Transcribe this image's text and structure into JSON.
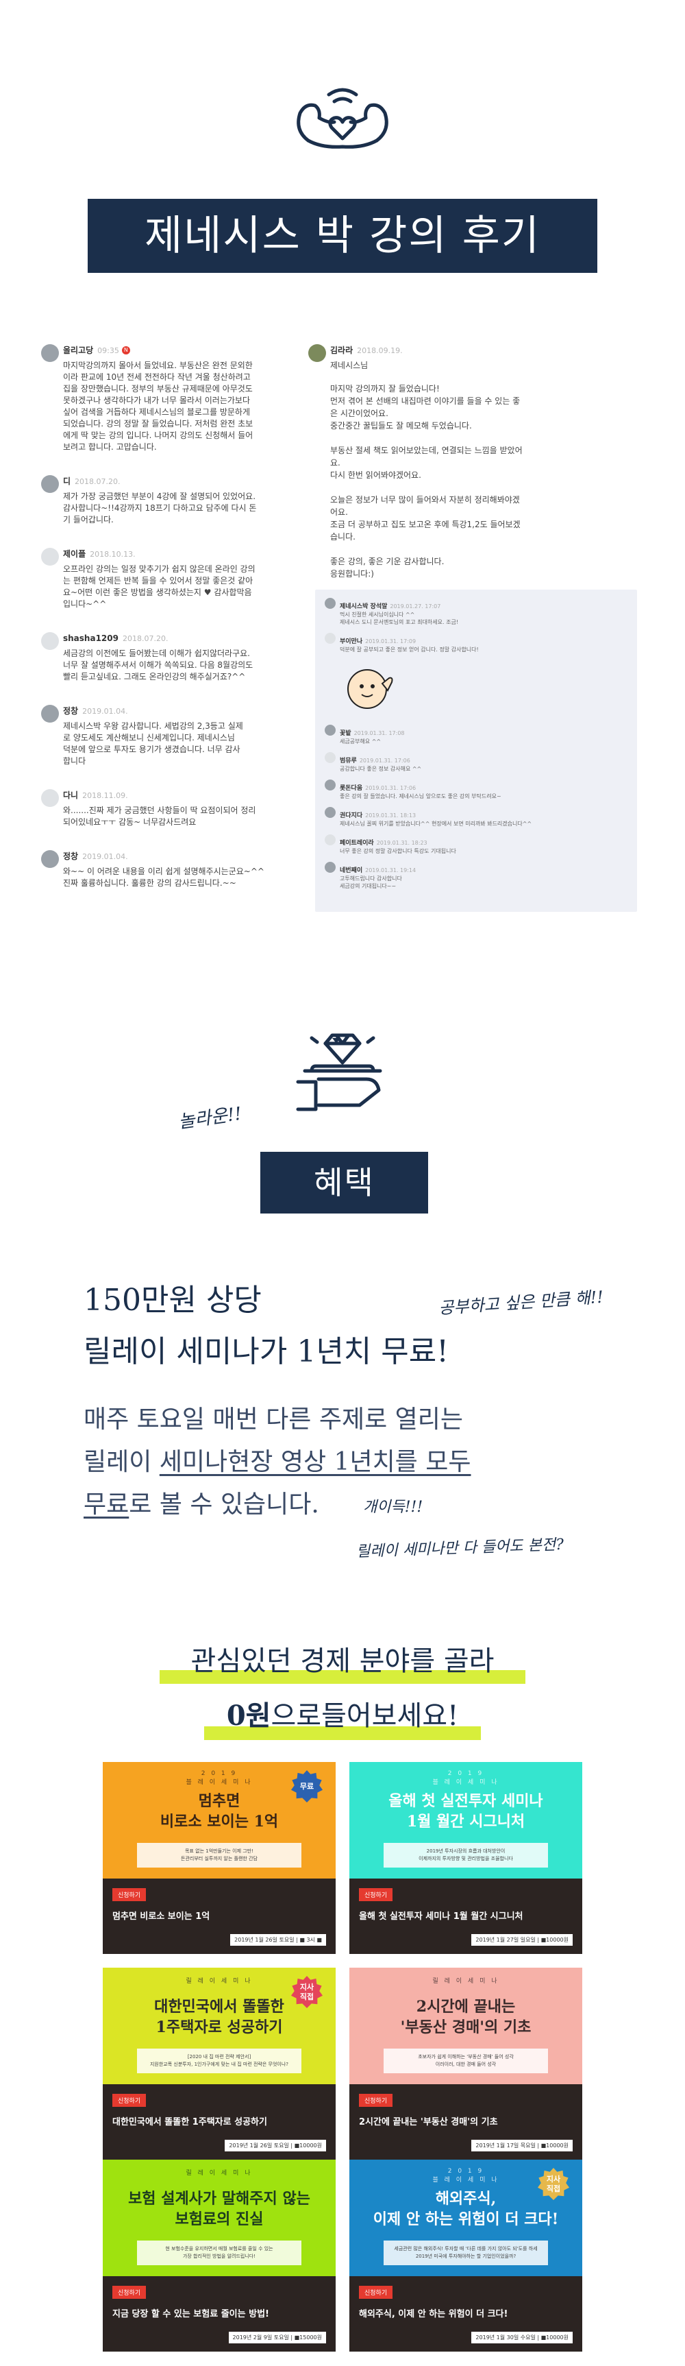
{
  "header": {
    "title": "제네시스 박 강의 후기",
    "icon": "muscle-heart-icon",
    "color_navy": "#1b2f4b"
  },
  "reviews_left": [
    {
      "name": "올리고당",
      "date": "09:35",
      "badge": "N",
      "text": "마지막강의까지 몰아서 들었네요.  부동산은 완전 문외한\n이라 판교에 10년 전세 전전하다 작년 겨울 청산하려고\n집을 장만했습니다. 정부의 부동산 규제때문에 아무것도\n못하겠구나 생각하다가 내가 너무 몰라서 이러는가보다\n싶어 검색을 거듭하다 제네시스님의 블로그를 방문하게\n되었습니다. 강의 정말 잘 들었습니다. 저처럼 완전 초보\n에게 딱 맞는 강의 입니다. 나머지 강의도 신청해서 들어\n보려고 합니다. 고맙습니다."
    },
    {
      "name": "디",
      "date": "2018.07.20.",
      "text": "제가 가장 궁금했던 부분이 4강에 잘 설명되어 있었어요.\n감사합니다~!!4강까지 18프기 다하고요 담주에 다시 돈\n기 들어갑니다."
    },
    {
      "name": "제이플",
      "date": "2018.10.13.",
      "text": "오프라인 강의는 일정 맞추기가 쉽지 않은데 온라인 강의\n는 편함해 언제든 반복 들을 수 있어서 정말 좋은것 같아\n요~어떤 이런 좋은 방법을 생각하셨는지 ♥ 감사합막음\n입니다~^^"
    },
    {
      "name": "shasha1209",
      "date": "2018.07.20.",
      "text": "세금강의 이전에도 들어봤는데 이해가 쉽지않더라구요.\n너무 잘 설명해주셔서 이해가 쏙쏙되요. 다음 8월강의도\n빨리 듣고싶네요. 그래도 온라인강의 해주실거죠?^^"
    },
    {
      "name": "정창",
      "date": "2019.01.04.",
      "text": "제네시스박 우왕 감사합니다. 세법강의 2,3등고 실제\n로 양도세도 계산해보니 신세계입니다. 제네시스님\n덕분에 앞으로 투자도 용기가 생겼습니다. 너무 감사\n합니다"
    },
    {
      "name": "다니",
      "date": "2018.11.09.",
      "text": "와.......진짜 제가 궁금했던 사항들이 딱 요점이되어 정리\n되어있네요ㅜㅜ 감동~  너무감사드려요"
    },
    {
      "name": "정창",
      "date": "2019.01.04.",
      "text": "와~~ 이 어려운 내용을 이리 쉽게 설명해주시는군요~^^\n진짜 훌륭하십니다. 훌륭한 강의 감사드립니다.~~"
    }
  ],
  "review_right": {
    "name": "김라라",
    "date": "2018.09.19.",
    "subtitle": "제네시스님",
    "text": "마지막 강의까지 잘 들었습니다!\n먼저 겪어 본 선배의 내집마련 이야기를 들을 수 있는 좋\n은 시간이었어요.\n중간중간 꿀팁들도 잘 메모해 두었습니다.\n\n부동산 절세 책도 읽어보았는데, 연결되는 느낌을 받았어\n요.\n다시 한번 읽어봐야겠어요.\n\n오늘은 정보가 너무 많이 들어와서 자분히 정리해봐야겠\n어요.\n조금 더 공부하고 집도 보고온 후에 특강1,2도 들어보겠\n습니다.\n\n좋은 강의, 좋은 기운 감사합니다.\n응원합니다:)"
  },
  "comments": [
    {
      "name": "제네시스박 장석말",
      "date": "2019.01.27. 17:07",
      "text": "먹시 친절한 세시님이십니다 ^^\n제네시스 도니 문서멘토님의 포고 최대하세요. 조금!"
    },
    {
      "name": "부이만나",
      "date": "2019.01.31. 17:09",
      "text": "덕분에 잘 공부되고 좋은 정보 얻어 갑니다. 정말 감사합니다!"
    },
    {
      "name": "꽃밭",
      "date": "2019.01.31. 17:08",
      "text": "세금공부해요 ^^"
    },
    {
      "name": "범뮤루",
      "date": "2019.01.31. 17:06",
      "text": "공감합니다 좋은 정보 감사해요 ^^"
    },
    {
      "name": "롯돈다움",
      "date": "2019.01.31. 17:06",
      "text": "좋은 강의 잘 들었습니다. 제네시스님 앞으로도 좋은 강의 부탁드려요~"
    },
    {
      "name": "권다지다",
      "date": "2019.01.31. 18:13",
      "text": "제네시스님 꼴찌 위기를 받았습니다^^ 현장에서 보면 미리까봐 봐드리겠습니다^^"
    },
    {
      "name": "페이트레이라",
      "date": "2019.01.31. 18:23",
      "text": "너무 좋은 강의 정말 감사합니다 특강도 기대됩니다"
    },
    {
      "name": "네번째이",
      "date": "2019.01.31. 19:14",
      "text": "고투해드립니다 감사합니다\n세금강의 기대됩니다~~"
    }
  ],
  "benefit": {
    "icon": "diamond-hand-icon",
    "handwriting_top": "놀라운!!",
    "title": "혜택",
    "price_line1": "150만원 상당",
    "price_line2": "릴레이 세미나가 1년치 무료!",
    "handwriting_right": "공부하고 싶은 만큼 해!!",
    "desc_part1": "매주 토요일 매번 다른 주제로 열리는",
    "desc_part2a": "릴레이 ",
    "desc_part2b": "세미나현장 영상 1년치를 모두",
    "desc_part3a": "무료",
    "desc_part3b": "로 볼 수 있습니다.",
    "handwriting_3": "개이득!!!",
    "handwriting_4": "릴레이 세미나만 다 들어도 본전?"
  },
  "cta": {
    "line1": "관심있던 경제 분야를 골라",
    "line2_bold": "0원",
    "line2_rest": "으로들어보세요!",
    "highlight_color": "#d7ee3b"
  },
  "cards": [
    {
      "small": "2 0 1 9\n블 레 이 세 미 나",
      "title": "멈추면\n비로소 보이는 1억",
      "desc": "목표 없는 1억만들기는 이제 그만!\n돈관리부터 실투까지 알는 플랜한 간담",
      "tag": "신청하기",
      "bottom_title": "멈추면 비로소 보이는 1억",
      "date": "2019년 1월 26일 토요일 | ■ 3시 ■",
      "badge": "무료",
      "top_color": "#f6a321",
      "title_color": "#3b2616",
      "badge_color": "#2b62b0"
    },
    {
      "small": "2 0 1 9\n블 레 이 세 미 나",
      "title": "올해 첫 실전투자 세미나\n1월 월간 시그니처",
      "desc": "2019년 투자시장의 흐름과 대처방안이\n이제까지의 투자방향 및 관리방법을 조율합니다",
      "tag": "신청하기",
      "bottom_title": "올해 첫 실전투자 세미나 1월 월간 시그니처",
      "date": "2019년 1월 27일 일요일 | ■10000원",
      "badge": "",
      "top_color": "#35e5cf",
      "title_color": "#ffffff",
      "badge_color": ""
    },
    {
      "small": "릴 레 이 세 미 나",
      "title": "대한민국에서 똘똘한\n1주택자로 성공하기",
      "desc": "[2020 내 집 마련 전략 제안서]\n지원한교폭 신분투자, 1인가구에게 맞는 내 집 마련 전략은 무엇이나?",
      "tag": "신청하기",
      "bottom_title": "대한민국에서 똘똘한 1주택자로 성공하기",
      "date": "2019년 1월 26일 토요일 | ■10000원",
      "badge": "지사\n직접",
      "top_color": "#dbe525",
      "title_color": "#2b2b2b",
      "badge_color": "#e4455a"
    },
    {
      "small": "릴 레 이 세 미 나",
      "title": "2시간에 끝내는\n'부동산 경매'의 기초",
      "desc": "초보자가 쉽게 이해하는 '부동산 경매' 들어 성각\n이러이러, 대한 경매 들어 성각",
      "tag": "신청하기",
      "bottom_title": "2시간에 끝내는 '부동산 경매'의 기초",
      "date": "2019년 1월 17일 목요일 | ■10000원",
      "badge": "",
      "top_color": "#f6b1a8",
      "title_color": "#3a2a2a",
      "badge_color": ""
    },
    {
      "small": "릴 레 이 세 미 나",
      "title": "보험 설계사가 말해주지 않는\n보험료의 진실",
      "desc": "현 보험수준을 유지하면서 매월 보험료를 줄일 수 있는\n가장 합리적인 방법을 알려드립니다!",
      "tag": "신청하기",
      "bottom_title": "지금 당장 할 수 있는 보험료 줄이는 방법!",
      "date": "2019년 2월 9일 토요일 | ■15000원",
      "badge": "",
      "top_color": "#9fe20f",
      "title_color": "#1c3b1f",
      "badge_color": ""
    },
    {
      "small": "2 0 1 9\n블 레 이 세 미 나",
      "title": "해외주식,\n이제 안 하는 위험이 더 크다!",
      "desc": "세금관련 많은 해외주식! 투자할 때 '다른 데를 가지 않아도 되'도를 하세\n2019년 미국에 투자해야하는 할 기업인이었을까?",
      "tag": "신청하기",
      "bottom_title": "해외주식, 이제 안 하는 위험이 더 크다!",
      "date": "2019년 1월 30일 수요일 | ■10000원",
      "badge": "지사\n직접",
      "top_color": "#1b87c7",
      "title_color": "#ffffff",
      "badge_color": "#e6b84b"
    }
  ]
}
